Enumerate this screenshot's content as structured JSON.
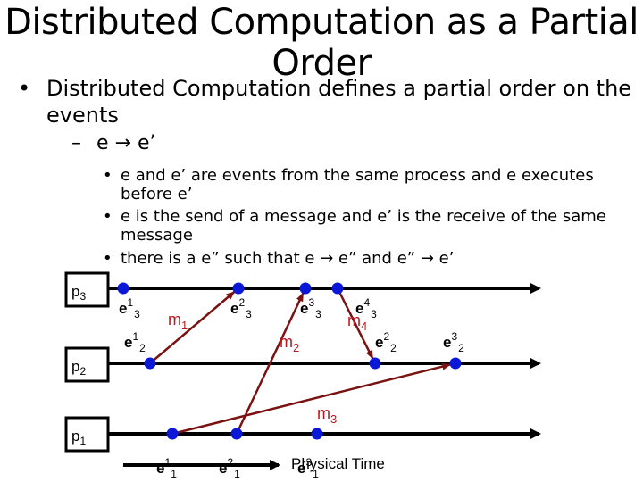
{
  "slide": {
    "title": "Distributed Computation as a Partial Order",
    "bullet": "Distributed Computation defines a partial order on the events",
    "bullet_marker": "•",
    "sub_bullet": {
      "marker": "–",
      "relation": "e → e’"
    },
    "sub_sub_bullets": [
      {
        "marker": "•",
        "text": "e and e’ are events from the same process and e executes before e’"
      },
      {
        "marker": "•",
        "text": "e is the send of a message and e’ is the receive of the same message"
      },
      {
        "marker": "•",
        "text": "there is a e” such that e → e” and e” → e’"
      }
    ]
  },
  "diagram": {
    "colors": {
      "timeline": "#000000",
      "event": "#0b18d8",
      "message_line": "#7a1212",
      "message_label": "#c0161f"
    },
    "processes": [
      {
        "id": "p3",
        "name": "p",
        "index": "3"
      },
      {
        "id": "p2",
        "name": "p",
        "index": "2"
      },
      {
        "id": "p1",
        "name": "p",
        "index": "1"
      }
    ],
    "events": [
      {
        "id": "e13",
        "process": "p3",
        "order": 1,
        "label": "e",
        "sup": "1",
        "sub": "3"
      },
      {
        "id": "e23",
        "process": "p3",
        "order": 2,
        "label": "e",
        "sup": "2",
        "sub": "3"
      },
      {
        "id": "e33",
        "process": "p3",
        "order": 3,
        "label": "e",
        "sup": "3",
        "sub": "3"
      },
      {
        "id": "e43",
        "process": "p3",
        "order": 4,
        "label": "e",
        "sup": "4",
        "sub": "3"
      },
      {
        "id": "e12",
        "process": "p2",
        "order": 1,
        "label": "e",
        "sup": "1",
        "sub": "2"
      },
      {
        "id": "e22",
        "process": "p2",
        "order": 2,
        "label": "e",
        "sup": "2",
        "sub": "2"
      },
      {
        "id": "e32",
        "process": "p2",
        "order": 3,
        "label": "e",
        "sup": "3",
        "sub": "2"
      },
      {
        "id": "e11",
        "process": "p1",
        "order": 1,
        "label": "e",
        "sup": "1",
        "sub": "1"
      },
      {
        "id": "e21",
        "process": "p1",
        "order": 2,
        "label": "e",
        "sup": "2",
        "sub": "1"
      },
      {
        "id": "e31",
        "process": "p1",
        "order": 3,
        "label": "e",
        "sup": "3",
        "sub": "1"
      }
    ],
    "messages": [
      {
        "id": "m1",
        "label": "m",
        "sub": "1",
        "from": "e12",
        "to": "e23"
      },
      {
        "id": "m2",
        "label": "m",
        "sub": "2",
        "from": "e21",
        "to": "e33"
      },
      {
        "id": "m3",
        "label": "m",
        "sub": "3",
        "from": "e11",
        "to": "e32"
      },
      {
        "id": "m4",
        "label": "m",
        "sub": "4",
        "from": "e43",
        "to": "e22"
      }
    ],
    "time_axis_label": "Physical Time"
  }
}
